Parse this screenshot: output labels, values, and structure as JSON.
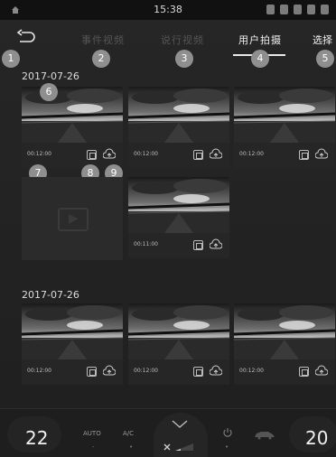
{
  "status_bar": {
    "time": "15:38"
  },
  "tabs": {
    "items": [
      {
        "label": "事件视频"
      },
      {
        "label": "说行视频"
      },
      {
        "label": "用户拍摄"
      }
    ],
    "select_label": "选择"
  },
  "badges": [
    "1",
    "2",
    "3",
    "4",
    "5",
    "6",
    "7",
    "8",
    "9"
  ],
  "sections": [
    {
      "date": "2017-07-26",
      "items": [
        {
          "time": "00:12:00"
        },
        {
          "time": "00:12:00"
        },
        {
          "time": "00:12:00"
        },
        {
          "time": "",
          "empty": true
        },
        {
          "time": "00:11:00"
        }
      ]
    },
    {
      "date": "2017-07-26",
      "items": [
        {
          "time": "00:12:00"
        },
        {
          "time": "00:12:00"
        },
        {
          "time": "00:12:00"
        }
      ]
    }
  ],
  "climate": {
    "left_temp": "22",
    "right_temp": "20",
    "auto_label": "AUTO",
    "ac_label": "A/C",
    "auto_indicator": "-",
    "ac_indicator": "•",
    "power_indicator": "•"
  },
  "icons": {
    "back": "back-arrow-icon",
    "download": "download-icon",
    "upload": "cloud-upload-icon",
    "fan": "fan-icon",
    "power": "power-icon",
    "car": "car-icon"
  }
}
